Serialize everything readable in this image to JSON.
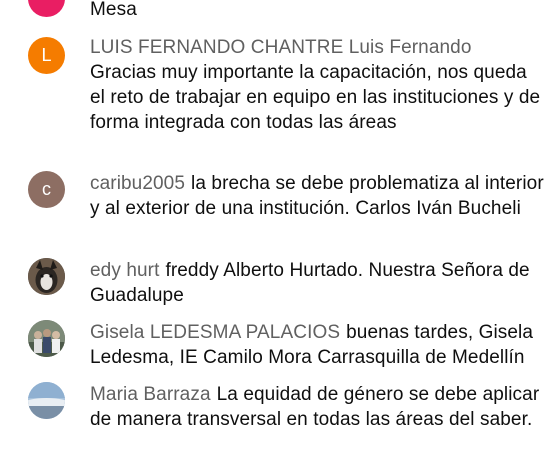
{
  "colors": {
    "author_text": "#606060",
    "message_text": "#0f0f0f",
    "avatar_pink": "#e91e63",
    "avatar_orange": "#f57c00",
    "avatar_brown": "#8d6e63"
  },
  "messages": [
    {
      "author": "",
      "text": "Mesa",
      "avatar": {
        "letter": "",
        "color": "#e91e63"
      }
    },
    {
      "author": "LUIS FERNANDO CHANTRE Luis Fernando",
      "text": "Gracias muy importante la capacitación, nos queda el reto de trabajar en equipo en las instituciones y de forma integrada con todas las áreas",
      "avatar": {
        "letter": "L",
        "color": "#f57c00"
      }
    },
    {
      "author": "caribu2005",
      "text": "la brecha se debe problematiza al interior y al exterior de una institución. Carlos Iván Bucheli",
      "avatar": {
        "letter": "c",
        "color": "#8d6e63"
      }
    },
    {
      "author": "edy hurt",
      "text": "freddy Alberto Hurtado. Nuestra Señora de Guadalupe",
      "avatar": {
        "letter": "",
        "color": "#4a4a4a"
      }
    },
    {
      "author": "Gisela LEDESMA PALACIOS",
      "text": "buenas tardes, Gisela Ledesma, IE Camilo Mora Carrasquilla de Medellín",
      "avatar": {
        "letter": "",
        "color": "#5a5a5a"
      }
    },
    {
      "author": "Maria Barraza",
      "text": "La equidad de género se debe aplicar de manera transversal en todas las áreas del saber.",
      "avatar": {
        "letter": "",
        "color": "#9fb6cf"
      }
    }
  ]
}
